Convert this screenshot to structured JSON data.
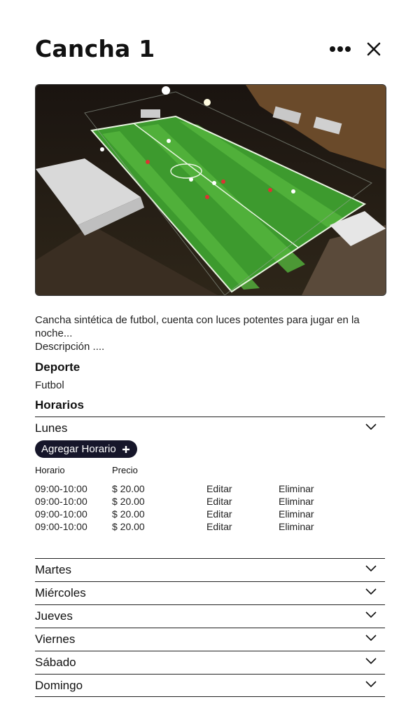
{
  "header": {
    "title": "Cancha 1",
    "more_icon": "more-horizontal-icon",
    "close_icon": "close-icon"
  },
  "image": {
    "description": "aerial-night-soccer-field-photo"
  },
  "description": {
    "line1": "Cancha sintética de futbol, cuenta con luces potentes para jugar en la noche...",
    "line2": "Descripción ...."
  },
  "sport": {
    "label": "Deporte",
    "value": "Futbol"
  },
  "schedules": {
    "label": "Horarios",
    "add_button": "Agregar Horario",
    "columns": {
      "time": "Horario",
      "price": "Precio"
    },
    "days": [
      "Lunes",
      "Martes",
      "Miércoles",
      "Jueves",
      "Viernes",
      "Sábado",
      "Domingo"
    ],
    "rows": [
      {
        "time": "09:00-10:00",
        "price": "$ 20.00",
        "edit": "Editar",
        "delete": "Eliminar"
      },
      {
        "time": "09:00-10:00",
        "price": "$ 20.00",
        "edit": "Editar",
        "delete": "Eliminar"
      },
      {
        "time": "09:00-10:00",
        "price": "$ 20.00",
        "edit": "Editar",
        "delete": "Eliminar"
      },
      {
        "time": "09:00-10:00",
        "price": "$ 20.00",
        "edit": "Editar",
        "delete": "Eliminar"
      }
    ]
  }
}
